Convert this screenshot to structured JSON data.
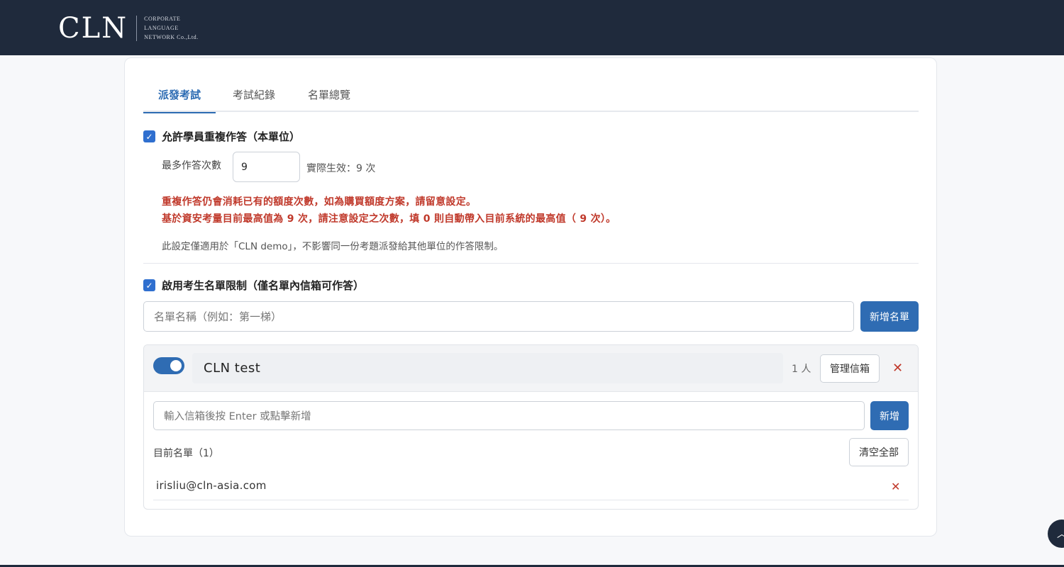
{
  "header": {
    "logo_mark": "CLN",
    "logo_sub": [
      "CORPORATE",
      "LANGUAGE",
      "NETWORK Co.,Ltd."
    ]
  },
  "tabs": [
    {
      "label": "派發考試",
      "active": true
    },
    {
      "label": "考試紀錄",
      "active": false
    },
    {
      "label": "名單總覽",
      "active": false
    }
  ],
  "repeat": {
    "checkbox_label": "允許學員重複作答（本單位）",
    "checked": true,
    "max_label": "最多作答次數",
    "max_value": "9",
    "effective_text": "實際生效：9 次",
    "warning_1": "重複作答仍會消耗已有的額度次數，如為購買額度方案，請留意設定。",
    "warning_2": "基於資安考量目前最高值為 9 次，請注意設定之次數，填 0 則自動帶入目前系統的最高值（ 9 次）。",
    "note": "此設定僅適用於「CLN demo」，不影響同一份考題派發給其他單位的作答限制。"
  },
  "roster": {
    "checkbox_label": "啟用考生名單限制（僅名單內信箱可作答）",
    "checked": true,
    "name_placeholder": "名單名稱（例如：第一梯）",
    "add_list_label": "新增名單",
    "list": {
      "enabled": true,
      "name": "CLN test",
      "count_text": "1 人",
      "manage_label": "管理信箱",
      "email_placeholder": "輸入信箱後按 Enter 或點擊新增",
      "add_label": "新增",
      "current_label": "目前名單（1）",
      "clear_label": "清空全部",
      "emails": [
        "irisliu@cln-asia.com"
      ]
    }
  },
  "colors": {
    "header_bg": "#1f2a3c",
    "accent": "#2f6cb3",
    "warning": "#c0392b"
  }
}
